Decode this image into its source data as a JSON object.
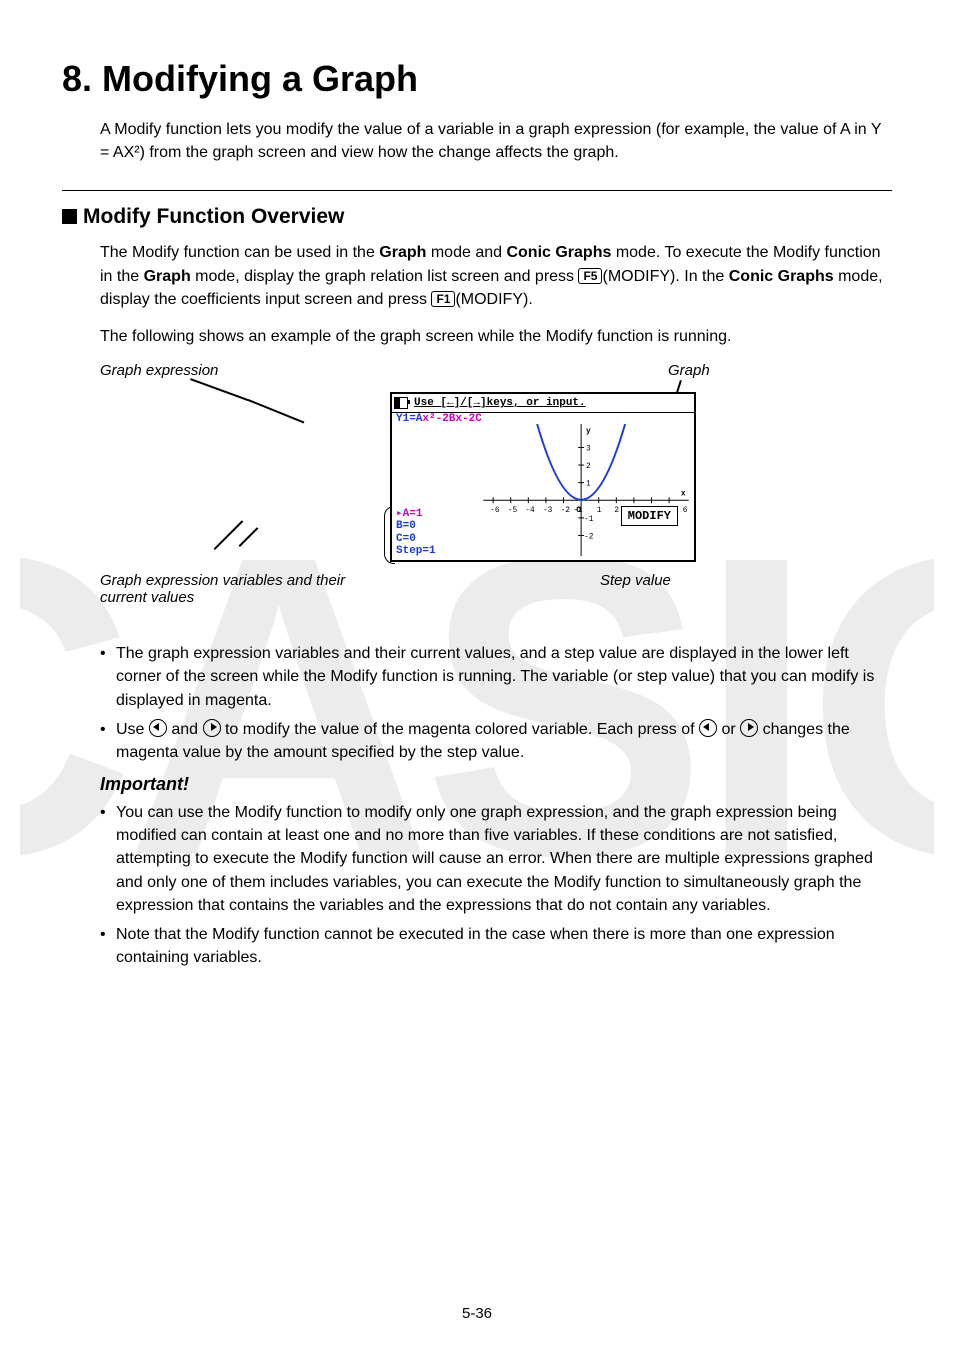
{
  "title": "8. Modifying a Graph",
  "intro_html": "A Modify function lets you modify the value of a variable in a graph expression (for example, the value of A in Y = AX²) from the graph screen and view how the change affects the graph.",
  "section_heading": "Modify Function Overview",
  "overview_p1_a": "The Modify function can be used in the ",
  "overview_p1_b": " mode and ",
  "overview_p1_c": " mode. To execute the Modify function in the ",
  "overview_p1_d": " mode, display the graph relation list screen and press ",
  "overview_p1_e": "(MODIFY). In the ",
  "overview_p1_f": " mode, display the coefficients input screen and press ",
  "overview_p1_g": "(MODIFY).",
  "bold_graph": "Graph",
  "bold_conic": "Conic Graphs",
  "key_f5": "F5",
  "key_f1": "F1",
  "overview_p2": "The following shows an example of the graph screen while the Modify function is running.",
  "fig": {
    "label_expr": "Graph expression",
    "label_graph": "Graph",
    "label_vars": "Graph expression variables and their current values",
    "label_step": "Step value",
    "calc_hint": "Use [←]/[→]keys, or input.",
    "calc_expr_prefix": "Y1=A",
    "calc_expr_mid": "x²-2B",
    "calc_expr_mag": "x-2C",
    "calc_var_a": "▸A=1",
    "calc_var_b": "B=0",
    "calc_var_c": "C=0",
    "calc_step": "Step=1",
    "calc_modify": "MODIFY"
  },
  "bullet1": "The graph expression variables and their current values, and a step value are displayed in the lower left corner of the screen while the Modify function is running. The variable (or step value) that you can modify is displayed in magenta.",
  "bullet2_a": "Use ",
  "bullet2_b": " and ",
  "bullet2_c": " to modify the value of the magenta colored variable. Each press of ",
  "bullet2_d": " or ",
  "bullet2_e": " changes the magenta value by the amount specified by the step value.",
  "important_heading": "Important!",
  "imp1": "You can use the Modify function to modify only one graph expression, and the graph expression being modified can contain at least one and no more than five variables. If these conditions are not satisfied, attempting to execute the Modify function will cause an error. When there are multiple expressions graphed and only one of them includes variables, you can execute the Modify function to simultaneously graph the expression that contains the variables and the expressions that do not contain any variables.",
  "imp2": "Note that the Modify function cannot be executed in the case when there is more than one expression containing variables.",
  "page_number": "5-36"
}
